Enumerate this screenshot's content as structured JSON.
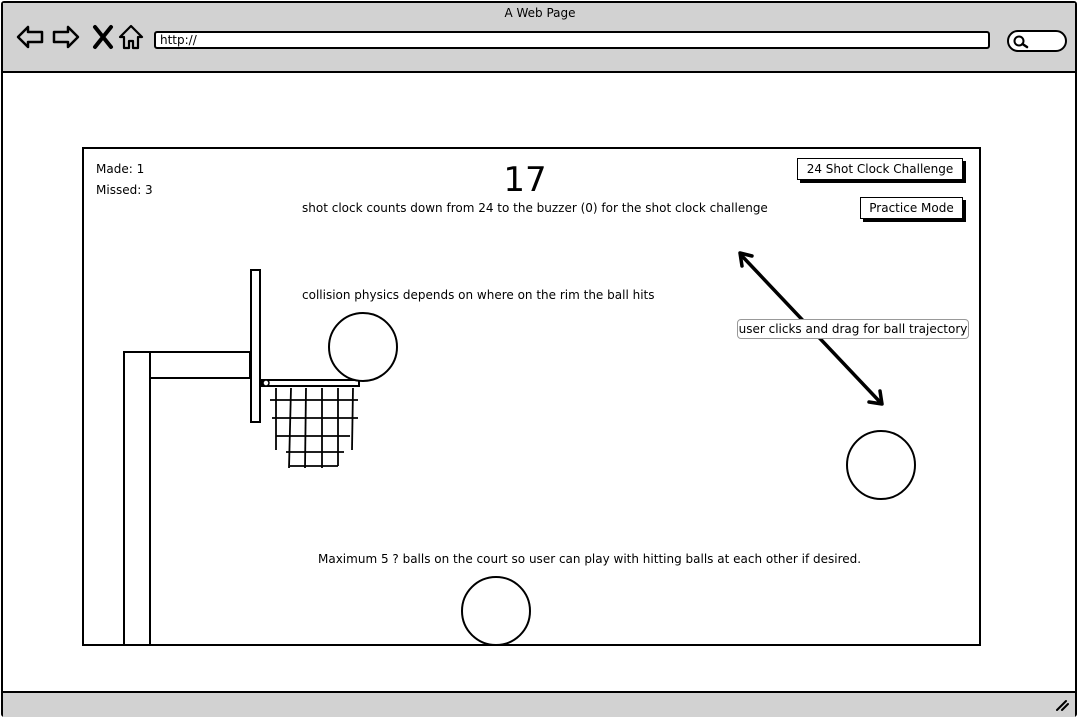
{
  "window": {
    "title": "A Web Page"
  },
  "browser": {
    "url": "http://"
  },
  "game": {
    "made_label": "Made: 1",
    "missed_label": "Missed: 3",
    "shot_clock": "17",
    "buttons": {
      "challenge": "24 Shot Clock Challenge",
      "practice": "Practice Mode"
    },
    "notes": {
      "shot_clock": "shot clock counts down from 24 to the buzzer (0) for the shot clock challenge",
      "collision": "collision physics depends on where on the rim the ball hits",
      "drag": "user clicks and drag for ball trajectory",
      "max_balls": "Maximum 5 ? balls on the court so user can play with hitting balls at each other if desired."
    }
  },
  "icons": [
    "back-arrow-icon",
    "forward-arrow-icon",
    "close-icon",
    "home-icon",
    "search-icon",
    "resize-icon"
  ]
}
